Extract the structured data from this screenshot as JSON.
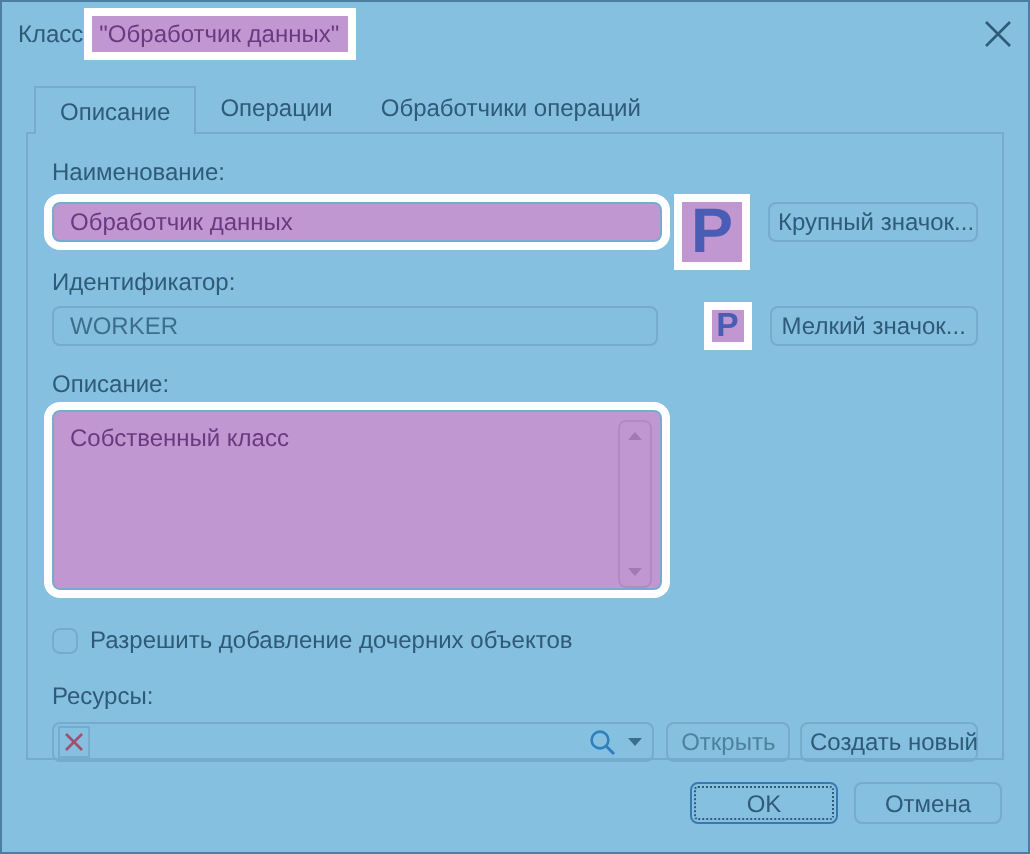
{
  "window": {
    "title_prefix": "Класс",
    "title_name": "\"Обработчик данных\"",
    "title_highlighted": true
  },
  "tabs": [
    {
      "label": "Описание",
      "selected": true
    },
    {
      "label": "Операции",
      "selected": false
    },
    {
      "label": "Обработчики операций",
      "selected": false
    }
  ],
  "name": {
    "label": "Наименование:",
    "value": "Обработчик данных",
    "highlighted": true
  },
  "large_icon": {
    "glyph": "P",
    "highlighted": true,
    "button": "Крупный значок..."
  },
  "identifier": {
    "label": "Идентификатор:",
    "value": "WORKER",
    "highlighted": false
  },
  "small_icon": {
    "glyph": "P",
    "highlighted": true,
    "button": "Мелкий значок..."
  },
  "description": {
    "label": "Описание:",
    "value": "Собственный класс",
    "highlighted": true
  },
  "allow_children": {
    "label": "Разрешить добавление дочерних объектов",
    "checked": false
  },
  "resources": {
    "label": "Ресурсы:",
    "open_button": {
      "label": "Открыть",
      "disabled": true
    },
    "create_button": {
      "label": "Создать новый",
      "disabled": false
    }
  },
  "buttons": [
    {
      "label": "OK",
      "focused": true
    },
    {
      "label": "Отмена",
      "focused": false
    }
  ]
}
